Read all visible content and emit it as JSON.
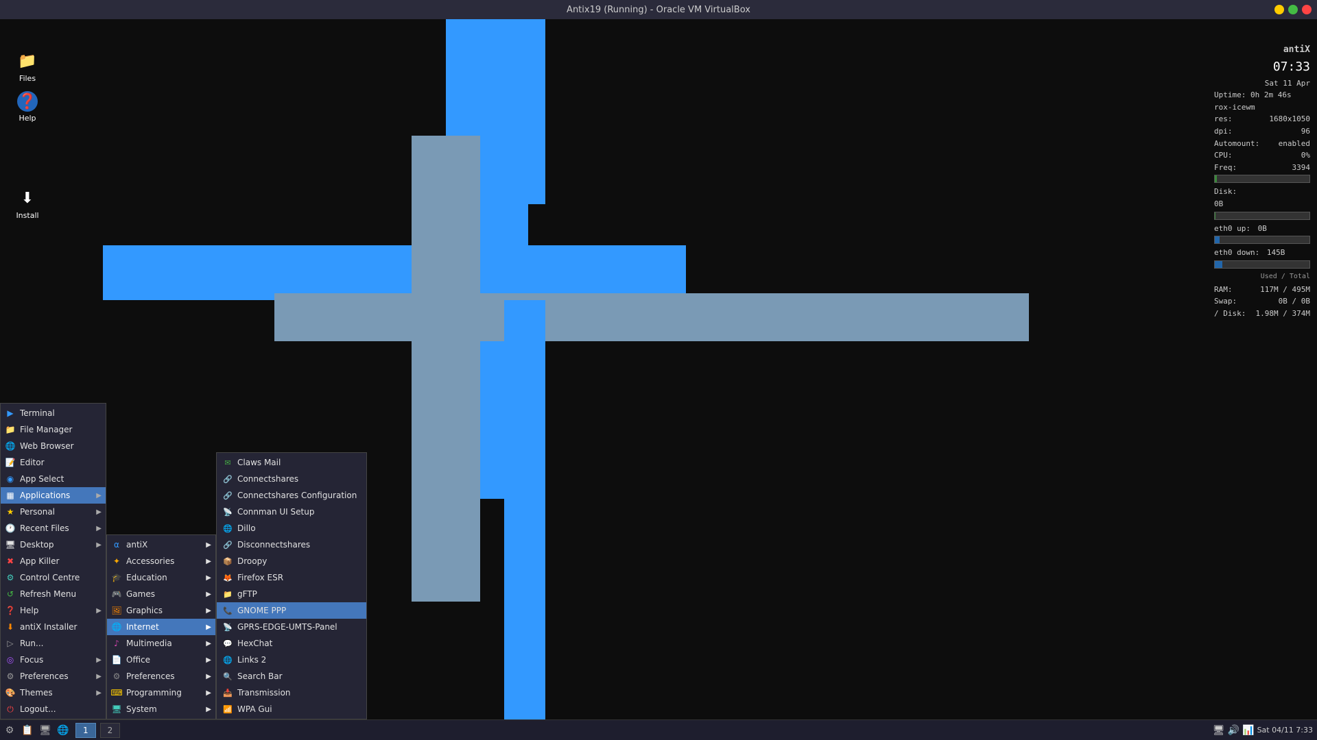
{
  "titlebar": {
    "title": "Antix19 (Running) - Oracle VM VirtualBox",
    "buttons": [
      {
        "color": "#ffcc00",
        "name": "minimize"
      },
      {
        "color": "#44bb44",
        "name": "maximize"
      },
      {
        "color": "#ff4444",
        "name": "close"
      }
    ]
  },
  "sysinfo": {
    "username": "antiX",
    "time": "07:33",
    "date": "Sat 11 Apr",
    "uptime": "Uptime: 0h 2m 46s",
    "wm": "rox-icewm",
    "res": "1680x1050",
    "dpi": "96",
    "automount": "enabled",
    "cpu": "0%",
    "freq": "3394",
    "disk_label": "Disk:",
    "disk_value": "0B",
    "eth0_up_label": "eth0 up:",
    "eth0_up_value": "0B",
    "eth0_down_label": "eth0 down:",
    "eth0_down_value": "145B",
    "ram_label": "RAM:",
    "ram_value": "117M / 495M",
    "swap_label": "Swap:",
    "swap_value": "0B / 0B",
    "disk2_label": "/ Disk:",
    "disk2_value": "1.98M / 374M",
    "used_total": "Used / Total"
  },
  "desktop_icons": [
    {
      "id": "files",
      "label": "Files",
      "icon": "📁"
    },
    {
      "id": "help",
      "label": "Help",
      "icon": "❓"
    },
    {
      "id": "install",
      "label": "Install",
      "icon": "⬇"
    }
  ],
  "taskbar": {
    "left_icons": [
      "⚙",
      "📋",
      "🖥",
      "🌐"
    ],
    "window1_label": "1",
    "window2_label": "2",
    "right_time": "Sat 04/11  7:33"
  },
  "main_menu": {
    "items": [
      {
        "id": "terminal",
        "label": "Terminal",
        "icon": "▶",
        "icon_color": "icon-blue",
        "has_arrow": false
      },
      {
        "id": "file-manager",
        "label": "File Manager",
        "icon": "📁",
        "has_arrow": false
      },
      {
        "id": "web-browser",
        "label": "Web Browser",
        "icon": "🌐",
        "has_arrow": false
      },
      {
        "id": "editor",
        "label": "Editor",
        "icon": "📝",
        "has_arrow": false
      },
      {
        "id": "app-select",
        "label": "App Select",
        "icon": "◉",
        "has_arrow": false
      },
      {
        "id": "applications",
        "label": "Applications",
        "icon": "▦",
        "has_arrow": true,
        "active": true
      },
      {
        "id": "personal",
        "label": "Personal",
        "icon": "★",
        "has_arrow": true
      },
      {
        "id": "recent-files",
        "label": "Recent Files",
        "icon": "🕐",
        "has_arrow": true
      },
      {
        "id": "desktop",
        "label": "Desktop",
        "icon": "🖥",
        "has_arrow": true
      },
      {
        "id": "app-killer",
        "label": "App Killer",
        "icon": "✖",
        "has_arrow": false
      },
      {
        "id": "control-centre",
        "label": "Control Centre",
        "icon": "⚙",
        "has_arrow": false
      },
      {
        "id": "refresh-menu",
        "label": "Refresh Menu",
        "icon": "↺",
        "has_arrow": false
      },
      {
        "id": "help",
        "label": "Help",
        "icon": "❓",
        "has_arrow": true
      },
      {
        "id": "antix-installer",
        "label": "antiX Installer",
        "icon": "⬇",
        "has_arrow": false
      },
      {
        "id": "run",
        "label": "Run...",
        "icon": "▷",
        "has_arrow": false
      },
      {
        "id": "focus",
        "label": "Focus",
        "icon": "◎",
        "has_arrow": true
      },
      {
        "id": "preferences",
        "label": "Preferences",
        "icon": "⚙",
        "has_arrow": true
      },
      {
        "id": "themes",
        "label": "Themes",
        "icon": "🎨",
        "has_arrow": true
      },
      {
        "id": "logout",
        "label": "Logout...",
        "icon": "⏻",
        "has_arrow": false
      }
    ]
  },
  "submenu_applications": {
    "items": [
      {
        "id": "antix",
        "label": "antiX",
        "has_arrow": true
      },
      {
        "id": "accessories",
        "label": "Accessories",
        "has_arrow": true
      },
      {
        "id": "education",
        "label": "Education",
        "has_arrow": true
      },
      {
        "id": "games",
        "label": "Games",
        "has_arrow": true
      },
      {
        "id": "graphics",
        "label": "Graphics",
        "has_arrow": true
      },
      {
        "id": "internet",
        "label": "Internet",
        "has_arrow": true,
        "active": true
      },
      {
        "id": "multimedia",
        "label": "Multimedia",
        "has_arrow": true
      },
      {
        "id": "office",
        "label": "Office",
        "has_arrow": true
      },
      {
        "id": "preferences",
        "label": "Preferences",
        "has_arrow": true
      },
      {
        "id": "programming",
        "label": "Programming",
        "has_arrow": true
      },
      {
        "id": "system",
        "label": "System",
        "has_arrow": true
      }
    ]
  },
  "submenu_internet": {
    "items": [
      {
        "id": "claws-mail",
        "label": "Claws Mail",
        "icon": "✉",
        "icon_color": "#44aa44"
      },
      {
        "id": "connectshares",
        "label": "Connectshares",
        "icon": "🔗",
        "icon_color": "#3399ff"
      },
      {
        "id": "connectshares-config",
        "label": "Connectshares Configuration",
        "icon": "🔗",
        "icon_color": "#3399ff"
      },
      {
        "id": "connman-ui",
        "label": "Connman UI Setup",
        "icon": "📡",
        "icon_color": "#3399ff"
      },
      {
        "id": "dillo",
        "label": "Dillo",
        "icon": "🌐",
        "icon_color": "#aaaaff"
      },
      {
        "id": "disconnectshares",
        "label": "Disconnectshares",
        "icon": "🔗",
        "icon_color": "#ff4444"
      },
      {
        "id": "droopy",
        "label": "Droopy",
        "icon": "📦",
        "icon_color": "#888"
      },
      {
        "id": "firefox-esr",
        "label": "Firefox ESR",
        "icon": "🦊",
        "icon_color": "#ff6600"
      },
      {
        "id": "gftp",
        "label": "gFTP",
        "icon": "📁",
        "icon_color": "#888"
      },
      {
        "id": "gnome-ppp",
        "label": "GNOME PPP",
        "icon": "📞",
        "icon_color": "#cc2222",
        "highlighted": true
      },
      {
        "id": "gprs-edge",
        "label": "GPRS-EDGE-UMTS-Panel",
        "icon": "📡",
        "icon_color": "#888"
      },
      {
        "id": "hexchat",
        "label": "HexChat",
        "icon": "💬",
        "icon_color": "#888"
      },
      {
        "id": "links2",
        "label": "Links 2",
        "icon": "🌐",
        "icon_color": "#888"
      },
      {
        "id": "search-bar",
        "label": "Search Bar",
        "icon": "🔍",
        "icon_color": "#3399ff"
      },
      {
        "id": "transmission",
        "label": "Transmission",
        "icon": "📥",
        "icon_color": "#cc4444"
      },
      {
        "id": "wpa-gui",
        "label": "WPA Gui",
        "icon": "📶",
        "icon_color": "#888"
      }
    ]
  }
}
